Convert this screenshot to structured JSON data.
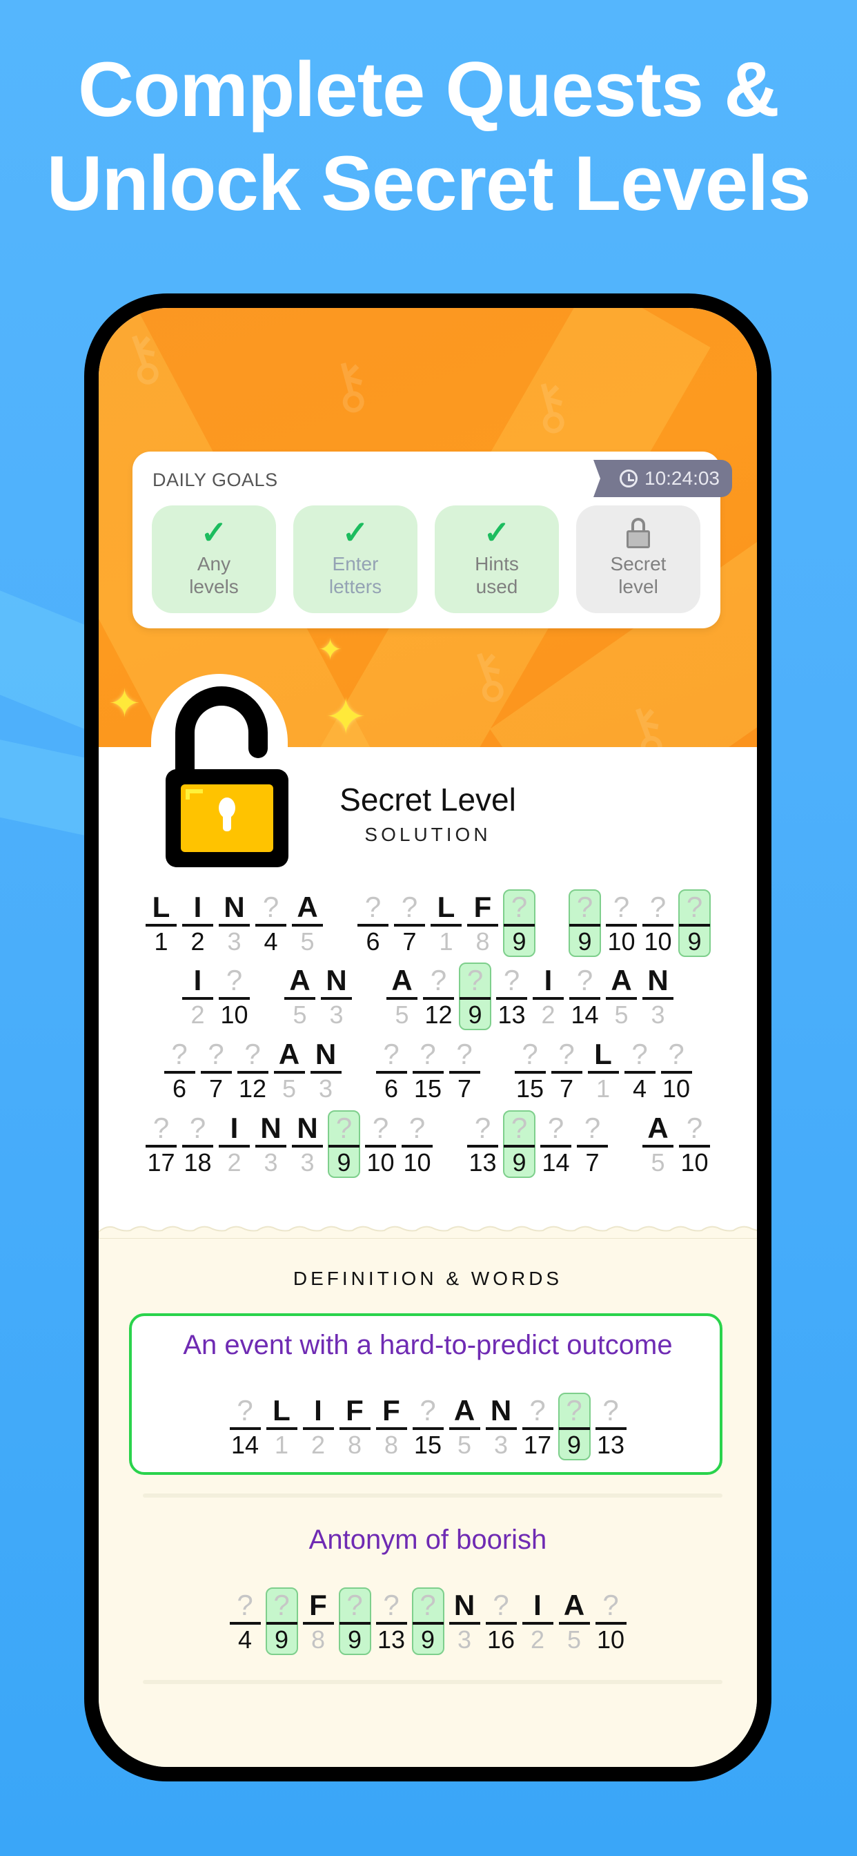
{
  "headline": {
    "line1": "Complete Quests &",
    "line2": "Unlock Secret Levels"
  },
  "colors": {
    "background_blue": "#4eb0fb",
    "header_orange": "#fb9722",
    "goal_done_green": "#d9f3d8",
    "check_green": "#1cbc5e",
    "highlight_green": "#c6f6cc",
    "definition_purple": "#6f2bb3",
    "cream": "#fef9e9",
    "timer_gray": "#777890"
  },
  "daily_goals": {
    "title": "DAILY GOALS",
    "timer": "10:24:03",
    "goals": [
      {
        "label_line1": "Any",
        "label_line2": "levels",
        "status": "complete",
        "icon": "check-icon"
      },
      {
        "label_line1": "Enter",
        "label_line2": "letters",
        "status": "complete",
        "icon": "check-icon"
      },
      {
        "label_line1": "Hints",
        "label_line2": "used",
        "status": "complete",
        "icon": "check-icon"
      },
      {
        "label_line1": "Secret",
        "label_line2": "level",
        "status": "locked",
        "icon": "lock-icon"
      }
    ]
  },
  "level": {
    "title": "Secret Level",
    "subtitle": "SOLUTION",
    "icon": "unlocked-padlock-icon"
  },
  "puzzle_rows": [
    [
      [
        [
          "L",
          "1",
          0,
          0
        ],
        [
          "I",
          "2",
          0,
          0
        ],
        [
          "N",
          "3",
          1,
          0
        ],
        [
          "?",
          "4",
          0,
          0
        ],
        [
          "A",
          "5",
          1,
          0
        ]
      ],
      [
        [
          "?",
          "6",
          0,
          0
        ],
        [
          "?",
          "7",
          0,
          0
        ],
        [
          "L",
          "1",
          1,
          0
        ],
        [
          "F",
          "8",
          1,
          0
        ],
        [
          "?",
          "9",
          0,
          1
        ]
      ],
      [
        [
          "?",
          "9",
          0,
          1
        ],
        [
          "?",
          "10",
          0,
          0
        ],
        [
          "?",
          "10",
          0,
          0
        ],
        [
          "?",
          "9",
          0,
          1
        ]
      ]
    ],
    [
      [
        [
          "I",
          "2",
          1,
          0
        ],
        [
          "?",
          "10",
          0,
          0
        ]
      ],
      [
        [
          "A",
          "5",
          1,
          0
        ],
        [
          "N",
          "3",
          1,
          0
        ]
      ],
      [
        [
          "A",
          "5",
          1,
          0
        ],
        [
          "?",
          "12",
          0,
          0
        ],
        [
          "?",
          "9",
          0,
          1
        ],
        [
          "?",
          "13",
          0,
          0
        ],
        [
          "I",
          "2",
          1,
          0
        ],
        [
          "?",
          "14",
          0,
          0
        ],
        [
          "A",
          "5",
          1,
          0
        ],
        [
          "N",
          "3",
          1,
          0
        ]
      ]
    ],
    [
      [
        [
          "?",
          "6",
          0,
          0
        ],
        [
          "?",
          "7",
          0,
          0
        ],
        [
          "?",
          "12",
          0,
          0
        ],
        [
          "A",
          "5",
          1,
          0
        ],
        [
          "N",
          "3",
          1,
          0
        ]
      ],
      [
        [
          "?",
          "6",
          0,
          0
        ],
        [
          "?",
          "15",
          0,
          0
        ],
        [
          "?",
          "7",
          0,
          0
        ]
      ],
      [
        [
          "?",
          "15",
          0,
          0
        ],
        [
          "?",
          "7",
          0,
          0
        ],
        [
          "L",
          "1",
          1,
          0
        ],
        [
          "?",
          "4",
          0,
          0
        ],
        [
          "?",
          "10",
          0,
          0
        ]
      ]
    ],
    [
      [
        [
          "?",
          "17",
          0,
          0
        ],
        [
          "?",
          "18",
          0,
          0
        ],
        [
          "I",
          "2",
          1,
          0
        ],
        [
          "N",
          "3",
          1,
          0
        ],
        [
          "N",
          "3",
          1,
          0
        ],
        [
          "?",
          "9",
          0,
          1
        ],
        [
          "?",
          "10",
          0,
          0
        ],
        [
          "?",
          "10",
          0,
          0
        ]
      ],
      [
        [
          "?",
          "13",
          0,
          0
        ],
        [
          "?",
          "9",
          0,
          1
        ],
        [
          "?",
          "14",
          0,
          0
        ],
        [
          "?",
          "7",
          0,
          0
        ]
      ],
      [
        [
          "A",
          "5",
          1,
          0
        ],
        [
          "?",
          "10",
          0,
          0
        ]
      ]
    ]
  ],
  "definitions": {
    "heading": "DEFINITION & WORDS",
    "items": [
      {
        "clue": "An event with a hard-to-predict outcome",
        "selected": true,
        "cells": [
          [
            "?",
            "14",
            0,
            0
          ],
          [
            "L",
            "1",
            1,
            0
          ],
          [
            "I",
            "2",
            1,
            0
          ],
          [
            "F",
            "8",
            1,
            0
          ],
          [
            "F",
            "8",
            1,
            0
          ],
          [
            "?",
            "15",
            0,
            0
          ],
          [
            "A",
            "5",
            1,
            0
          ],
          [
            "N",
            "3",
            1,
            0
          ],
          [
            "?",
            "17",
            0,
            0
          ],
          [
            "?",
            "9",
            0,
            1
          ],
          [
            "?",
            "13",
            0,
            0
          ]
        ]
      },
      {
        "clue": "Antonym of boorish",
        "selected": false,
        "cells": [
          [
            "?",
            "4",
            0,
            0
          ],
          [
            "?",
            "9",
            0,
            1
          ],
          [
            "F",
            "8",
            1,
            0
          ],
          [
            "?",
            "9",
            0,
            1
          ],
          [
            "?",
            "13",
            0,
            0
          ],
          [
            "?",
            "9",
            0,
            1
          ],
          [
            "N",
            "3",
            1,
            0
          ],
          [
            "?",
            "16",
            0,
            0
          ],
          [
            "I",
            "2",
            1,
            0
          ],
          [
            "A",
            "5",
            1,
            0
          ],
          [
            "?",
            "10",
            0,
            0
          ]
        ]
      }
    ]
  }
}
